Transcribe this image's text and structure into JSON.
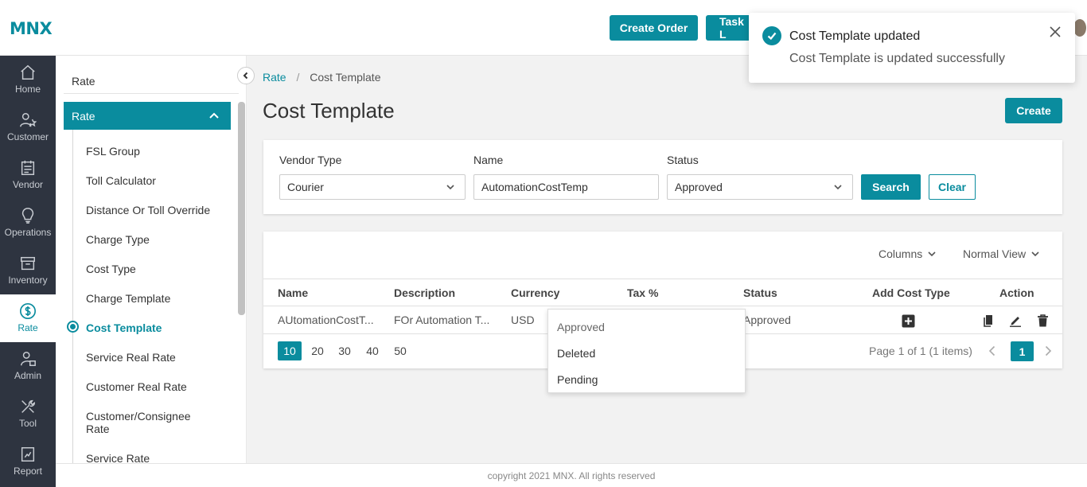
{
  "brand": {
    "logo": "MNX",
    "accent": "#0a8c9e"
  },
  "topbar": {
    "create_order": "Create Order",
    "task": "Task L"
  },
  "rail": {
    "items": [
      {
        "label": "Home",
        "icon": "home-icon"
      },
      {
        "label": "Customer",
        "icon": "customer-icon"
      },
      {
        "label": "Vendor",
        "icon": "vendor-icon"
      },
      {
        "label": "Operations",
        "icon": "lightbulb-icon"
      },
      {
        "label": "Inventory",
        "icon": "box-icon"
      },
      {
        "label": "Rate",
        "icon": "dollar-icon",
        "active": true
      },
      {
        "label": "Admin",
        "icon": "admin-icon"
      },
      {
        "label": "Tool",
        "icon": "tools-icon"
      },
      {
        "label": "Report",
        "icon": "report-icon"
      }
    ]
  },
  "submenu": {
    "title": "Rate",
    "group": "Rate",
    "items": [
      "FSL Group",
      "Toll Calculator",
      "Distance Or Toll Override",
      "Charge Type",
      "Cost Type",
      "Charge Template",
      "Cost Template",
      "Service Real Rate",
      "Customer Real Rate",
      "Customer/Consignee Rate",
      "Service Rate"
    ]
  },
  "breadcrumb": {
    "parent": "Rate",
    "separator": "/",
    "current": "Cost Template"
  },
  "page": {
    "title": "Cost Template",
    "create": "Create"
  },
  "filters": {
    "vendor_type": {
      "label": "Vendor Type",
      "value": "Courier"
    },
    "name": {
      "label": "Name",
      "value": "AutomationCostTemp"
    },
    "status": {
      "label": "Status",
      "value": "Approved"
    },
    "search": "Search",
    "clear": "Clear"
  },
  "grid": {
    "columns_btn": "Columns",
    "view_btn": "Normal View",
    "headers": [
      "Name",
      "Description",
      "Currency",
      "Tax %",
      "Status",
      "Add Cost Type",
      "Action"
    ],
    "rows": [
      {
        "name": "AUtomationCostT...",
        "description": "FOr Automation T...",
        "currency": "USD",
        "tax": "",
        "status": "Approved"
      }
    ],
    "page_sizes": [
      "10",
      "20",
      "30",
      "40",
      "50"
    ],
    "page_info": "Page 1 of 1 (1 items)",
    "current_page": "1"
  },
  "status_dropdown": {
    "options": [
      "Approved",
      "Deleted",
      "Pending"
    ]
  },
  "toast": {
    "title": "Cost Template updated",
    "message": "Cost Template is updated successfully"
  },
  "footer": "copyright 2021 MNX. All rights reserved"
}
